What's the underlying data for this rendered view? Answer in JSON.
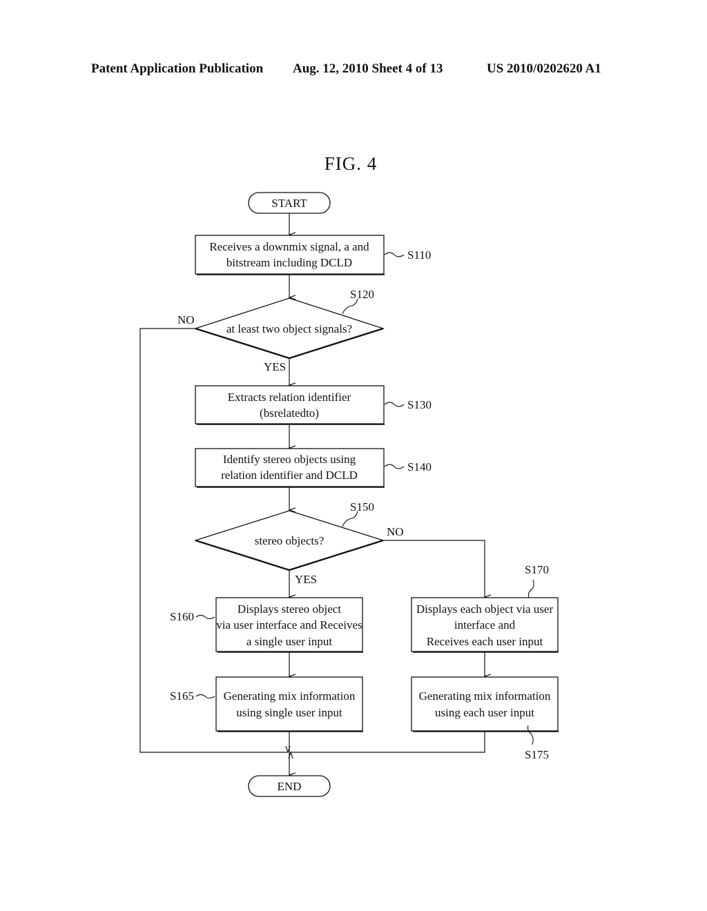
{
  "header": {
    "publication": "Patent Application Publication",
    "date_sheet": "Aug. 12, 2010  Sheet 4 of 13",
    "number": "US 2010/0202620 A1"
  },
  "figure": {
    "title": "FIG. 4"
  },
  "flowchart": {
    "start": "START",
    "end": "END",
    "s110": {
      "id": "S110",
      "lines": [
        "Receives a downmix signal, a and",
        "bitstream including DCLD"
      ]
    },
    "s120": {
      "id": "S120",
      "question": "at least two object signals?",
      "yes": "YES",
      "no": "NO"
    },
    "s130": {
      "id": "S130",
      "lines": [
        "Extracts relation identifier",
        "(bsrelatedto)"
      ]
    },
    "s140": {
      "id": "S140",
      "lines": [
        "Identify stereo objects using",
        "relation identifier and DCLD"
      ]
    },
    "s150": {
      "id": "S150",
      "question": "stereo objects?",
      "yes": "YES",
      "no": "NO"
    },
    "s160": {
      "id": "S160",
      "lines": [
        "Displays stereo object",
        "via user interface and Receives",
        "a single user input"
      ]
    },
    "s165": {
      "id": "S165",
      "lines": [
        "Generating mix information",
        "using single user input"
      ]
    },
    "s170": {
      "id": "S170",
      "lines": [
        "Displays each object via user",
        "interface and",
        "Receives each user input"
      ]
    },
    "s175": {
      "id": "S175",
      "lines": [
        "Generating mix information",
        "using each user input"
      ]
    }
  }
}
